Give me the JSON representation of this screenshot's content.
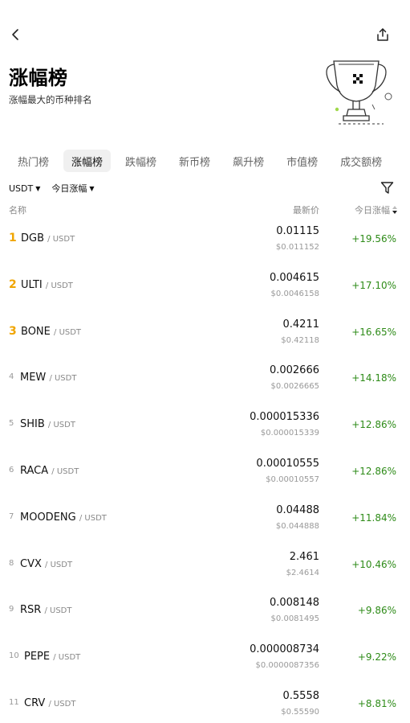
{
  "header": {
    "title": "涨幅榜",
    "subtitle": "涨幅最大的币种排名"
  },
  "tabs": [
    {
      "label": "热门榜"
    },
    {
      "label": "涨幅榜"
    },
    {
      "label": "跌幅榜"
    },
    {
      "label": "新币榜"
    },
    {
      "label": "飙升榜"
    },
    {
      "label": "市值榜"
    },
    {
      "label": "成交额榜"
    }
  ],
  "filters": {
    "quote": "USDT",
    "period": "今日涨幅"
  },
  "columns": {
    "name": "名称",
    "price": "最新价",
    "change": "今日涨幅"
  },
  "rows": [
    {
      "rank": "1",
      "base": "DGB",
      "quote": "/ USDT",
      "price": "0.01115",
      "usd": "$0.011152",
      "change": "+19.56%"
    },
    {
      "rank": "2",
      "base": "ULTI",
      "quote": "/ USDT",
      "price": "0.004615",
      "usd": "$0.0046158",
      "change": "+17.10%"
    },
    {
      "rank": "3",
      "base": "BONE",
      "quote": "/ USDT",
      "price": "0.4211",
      "usd": "$0.42118",
      "change": "+16.65%"
    },
    {
      "rank": "4",
      "base": "MEW",
      "quote": "/ USDT",
      "price": "0.002666",
      "usd": "$0.0026665",
      "change": "+14.18%"
    },
    {
      "rank": "5",
      "base": "SHIB",
      "quote": "/ USDT",
      "price": "0.000015336",
      "usd": "$0.000015339",
      "change": "+12.86%"
    },
    {
      "rank": "6",
      "base": "RACA",
      "quote": "/ USDT",
      "price": "0.00010555",
      "usd": "$0.00010557",
      "change": "+12.86%"
    },
    {
      "rank": "7",
      "base": "MOODENG",
      "quote": "/ USDT",
      "price": "0.04488",
      "usd": "$0.044888",
      "change": "+11.84%"
    },
    {
      "rank": "8",
      "base": "CVX",
      "quote": "/ USDT",
      "price": "2.461",
      "usd": "$2.4614",
      "change": "+10.46%"
    },
    {
      "rank": "9",
      "base": "RSR",
      "quote": "/ USDT",
      "price": "0.008148",
      "usd": "$0.0081495",
      "change": "+9.86%"
    },
    {
      "rank": "10",
      "base": "PEPE",
      "quote": "/ USDT",
      "price": "0.000008734",
      "usd": "$0.0000087356",
      "change": "+9.22%"
    },
    {
      "rank": "11",
      "base": "CRV",
      "quote": "/ USDT",
      "price": "0.5558",
      "usd": "$0.55590",
      "change": "+8.81%"
    }
  ],
  "colors": {
    "positive": "#2e8b18",
    "top_rank": "#f0a500",
    "tab_active_bg": "#f0f0f0"
  },
  "icons": {
    "back": "chevron-left-icon",
    "share": "share-icon",
    "filter": "filter-icon",
    "trophy": "trophy-illustration",
    "sort": "sort-icon"
  }
}
